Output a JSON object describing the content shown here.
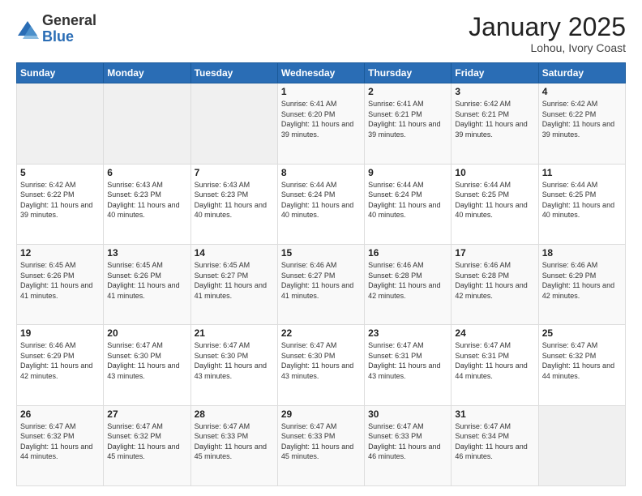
{
  "header": {
    "logo_general": "General",
    "logo_blue": "Blue",
    "title": "January 2025",
    "subtitle": "Lohou, Ivory Coast"
  },
  "calendar": {
    "days_of_week": [
      "Sunday",
      "Monday",
      "Tuesday",
      "Wednesday",
      "Thursday",
      "Friday",
      "Saturday"
    ],
    "weeks": [
      [
        {
          "day": "",
          "sunrise": "",
          "sunset": "",
          "daylight": "",
          "empty": true
        },
        {
          "day": "",
          "sunrise": "",
          "sunset": "",
          "daylight": "",
          "empty": true
        },
        {
          "day": "",
          "sunrise": "",
          "sunset": "",
          "daylight": "",
          "empty": true
        },
        {
          "day": "1",
          "sunrise": "Sunrise: 6:41 AM",
          "sunset": "Sunset: 6:20 PM",
          "daylight": "Daylight: 11 hours and 39 minutes."
        },
        {
          "day": "2",
          "sunrise": "Sunrise: 6:41 AM",
          "sunset": "Sunset: 6:21 PM",
          "daylight": "Daylight: 11 hours and 39 minutes."
        },
        {
          "day": "3",
          "sunrise": "Sunrise: 6:42 AM",
          "sunset": "Sunset: 6:21 PM",
          "daylight": "Daylight: 11 hours and 39 minutes."
        },
        {
          "day": "4",
          "sunrise": "Sunrise: 6:42 AM",
          "sunset": "Sunset: 6:22 PM",
          "daylight": "Daylight: 11 hours and 39 minutes."
        }
      ],
      [
        {
          "day": "5",
          "sunrise": "Sunrise: 6:42 AM",
          "sunset": "Sunset: 6:22 PM",
          "daylight": "Daylight: 11 hours and 39 minutes."
        },
        {
          "day": "6",
          "sunrise": "Sunrise: 6:43 AM",
          "sunset": "Sunset: 6:23 PM",
          "daylight": "Daylight: 11 hours and 40 minutes."
        },
        {
          "day": "7",
          "sunrise": "Sunrise: 6:43 AM",
          "sunset": "Sunset: 6:23 PM",
          "daylight": "Daylight: 11 hours and 40 minutes."
        },
        {
          "day": "8",
          "sunrise": "Sunrise: 6:44 AM",
          "sunset": "Sunset: 6:24 PM",
          "daylight": "Daylight: 11 hours and 40 minutes."
        },
        {
          "day": "9",
          "sunrise": "Sunrise: 6:44 AM",
          "sunset": "Sunset: 6:24 PM",
          "daylight": "Daylight: 11 hours and 40 minutes."
        },
        {
          "day": "10",
          "sunrise": "Sunrise: 6:44 AM",
          "sunset": "Sunset: 6:25 PM",
          "daylight": "Daylight: 11 hours and 40 minutes."
        },
        {
          "day": "11",
          "sunrise": "Sunrise: 6:44 AM",
          "sunset": "Sunset: 6:25 PM",
          "daylight": "Daylight: 11 hours and 40 minutes."
        }
      ],
      [
        {
          "day": "12",
          "sunrise": "Sunrise: 6:45 AM",
          "sunset": "Sunset: 6:26 PM",
          "daylight": "Daylight: 11 hours and 41 minutes."
        },
        {
          "day": "13",
          "sunrise": "Sunrise: 6:45 AM",
          "sunset": "Sunset: 6:26 PM",
          "daylight": "Daylight: 11 hours and 41 minutes."
        },
        {
          "day": "14",
          "sunrise": "Sunrise: 6:45 AM",
          "sunset": "Sunset: 6:27 PM",
          "daylight": "Daylight: 11 hours and 41 minutes."
        },
        {
          "day": "15",
          "sunrise": "Sunrise: 6:46 AM",
          "sunset": "Sunset: 6:27 PM",
          "daylight": "Daylight: 11 hours and 41 minutes."
        },
        {
          "day": "16",
          "sunrise": "Sunrise: 6:46 AM",
          "sunset": "Sunset: 6:28 PM",
          "daylight": "Daylight: 11 hours and 42 minutes."
        },
        {
          "day": "17",
          "sunrise": "Sunrise: 6:46 AM",
          "sunset": "Sunset: 6:28 PM",
          "daylight": "Daylight: 11 hours and 42 minutes."
        },
        {
          "day": "18",
          "sunrise": "Sunrise: 6:46 AM",
          "sunset": "Sunset: 6:29 PM",
          "daylight": "Daylight: 11 hours and 42 minutes."
        }
      ],
      [
        {
          "day": "19",
          "sunrise": "Sunrise: 6:46 AM",
          "sunset": "Sunset: 6:29 PM",
          "daylight": "Daylight: 11 hours and 42 minutes."
        },
        {
          "day": "20",
          "sunrise": "Sunrise: 6:47 AM",
          "sunset": "Sunset: 6:30 PM",
          "daylight": "Daylight: 11 hours and 43 minutes."
        },
        {
          "day": "21",
          "sunrise": "Sunrise: 6:47 AM",
          "sunset": "Sunset: 6:30 PM",
          "daylight": "Daylight: 11 hours and 43 minutes."
        },
        {
          "day": "22",
          "sunrise": "Sunrise: 6:47 AM",
          "sunset": "Sunset: 6:30 PM",
          "daylight": "Daylight: 11 hours and 43 minutes."
        },
        {
          "day": "23",
          "sunrise": "Sunrise: 6:47 AM",
          "sunset": "Sunset: 6:31 PM",
          "daylight": "Daylight: 11 hours and 43 minutes."
        },
        {
          "day": "24",
          "sunrise": "Sunrise: 6:47 AM",
          "sunset": "Sunset: 6:31 PM",
          "daylight": "Daylight: 11 hours and 44 minutes."
        },
        {
          "day": "25",
          "sunrise": "Sunrise: 6:47 AM",
          "sunset": "Sunset: 6:32 PM",
          "daylight": "Daylight: 11 hours and 44 minutes."
        }
      ],
      [
        {
          "day": "26",
          "sunrise": "Sunrise: 6:47 AM",
          "sunset": "Sunset: 6:32 PM",
          "daylight": "Daylight: 11 hours and 44 minutes."
        },
        {
          "day": "27",
          "sunrise": "Sunrise: 6:47 AM",
          "sunset": "Sunset: 6:32 PM",
          "daylight": "Daylight: 11 hours and 45 minutes."
        },
        {
          "day": "28",
          "sunrise": "Sunrise: 6:47 AM",
          "sunset": "Sunset: 6:33 PM",
          "daylight": "Daylight: 11 hours and 45 minutes."
        },
        {
          "day": "29",
          "sunrise": "Sunrise: 6:47 AM",
          "sunset": "Sunset: 6:33 PM",
          "daylight": "Daylight: 11 hours and 45 minutes."
        },
        {
          "day": "30",
          "sunrise": "Sunrise: 6:47 AM",
          "sunset": "Sunset: 6:33 PM",
          "daylight": "Daylight: 11 hours and 46 minutes."
        },
        {
          "day": "31",
          "sunrise": "Sunrise: 6:47 AM",
          "sunset": "Sunset: 6:34 PM",
          "daylight": "Daylight: 11 hours and 46 minutes."
        },
        {
          "day": "",
          "sunrise": "",
          "sunset": "",
          "daylight": "",
          "empty": true
        }
      ]
    ]
  }
}
